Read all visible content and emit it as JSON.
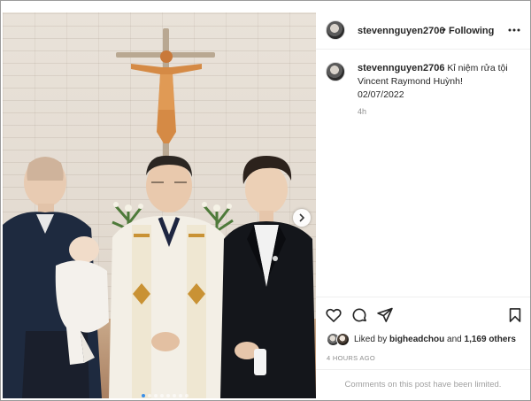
{
  "post": {
    "username": "stevennguyen2706",
    "separator": "•",
    "follow_state": "Following",
    "caption": {
      "username": "stevennguyen2706",
      "line1": "Kỉ niệm rửa tội",
      "line2": "Vincent Raymond Huỳnh!",
      "line3": "02/07/2022"
    },
    "time_ago": "4h",
    "likes": {
      "prefix": "Liked by ",
      "user": "bigheadchou",
      "middle": " and ",
      "count": "1,169 others"
    },
    "posted": "4 HOURS AGO",
    "comments_notice": "Comments on this post have been limited."
  },
  "carousel": {
    "total": 8,
    "active": 0
  },
  "icons": {
    "more": "more-horizontal-icon",
    "like": "heart-icon",
    "comment": "comment-bubble-icon",
    "share": "paper-plane-icon",
    "save": "bookmark-icon",
    "next": "chevron-right-icon"
  },
  "colors": {
    "carousel_active": "#3a8fe8",
    "muted": "#8e8e8e",
    "text": "#262626"
  }
}
